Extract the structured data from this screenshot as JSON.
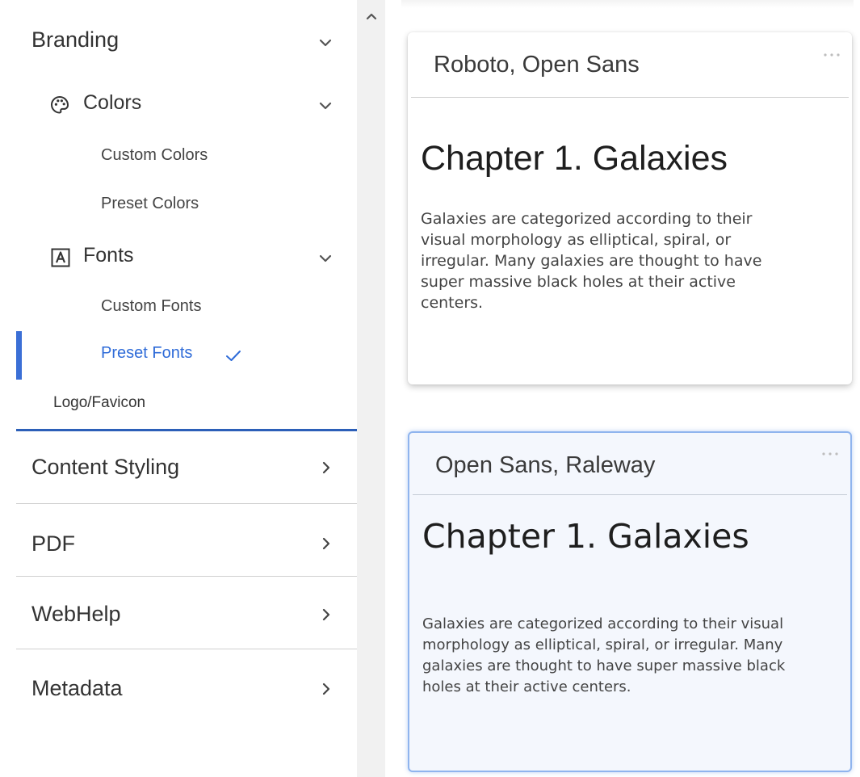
{
  "sidebar": {
    "branding": {
      "label": "Branding",
      "icon": "chevron-down-icon",
      "colors": {
        "label": "Colors",
        "icon": "palette-icon",
        "items": [
          "Custom Colors",
          "Preset Colors"
        ]
      },
      "fonts": {
        "label": "Fonts",
        "icon": "font-icon",
        "items": [
          "Custom Fonts",
          "Preset Fonts"
        ],
        "selected": "Preset Fonts",
        "selected_icon": "check-icon"
      },
      "logo": "Logo/Favicon"
    },
    "sections": [
      {
        "label": "Content Styling",
        "icon": "chevron-right-icon"
      },
      {
        "label": "PDF",
        "icon": "chevron-right-icon"
      },
      {
        "label": "WebHelp",
        "icon": "chevron-right-icon"
      },
      {
        "label": "Metadata",
        "icon": "chevron-right-icon"
      }
    ]
  },
  "scrollbar": {
    "icon": "arrow-up-icon"
  },
  "cards": [
    {
      "title": "Roboto, Open Sans",
      "heading": "Chapter 1. Galaxies",
      "body": "Galaxies are categorized according to their visual morphology as elliptical, spiral, or irregular. Many galaxies are thought to have super massive black holes at their active centers.",
      "selected": false
    },
    {
      "title": "Open Sans, Raleway",
      "heading": "Chapter 1. Galaxies",
      "body": "Galaxies are categorized according to their visual morphology as elliptical, spiral, or irregular. Many galaxies are thought to have super massive black holes at their active centers.",
      "selected": true
    }
  ],
  "colors": {
    "accent": "#2e6bd8",
    "active_indicator": "#3b6fd6",
    "section_underline": "#2c5fb8",
    "selected_card_border": "#8fb4ee",
    "selected_card_bg": "#f4f7fd"
  }
}
